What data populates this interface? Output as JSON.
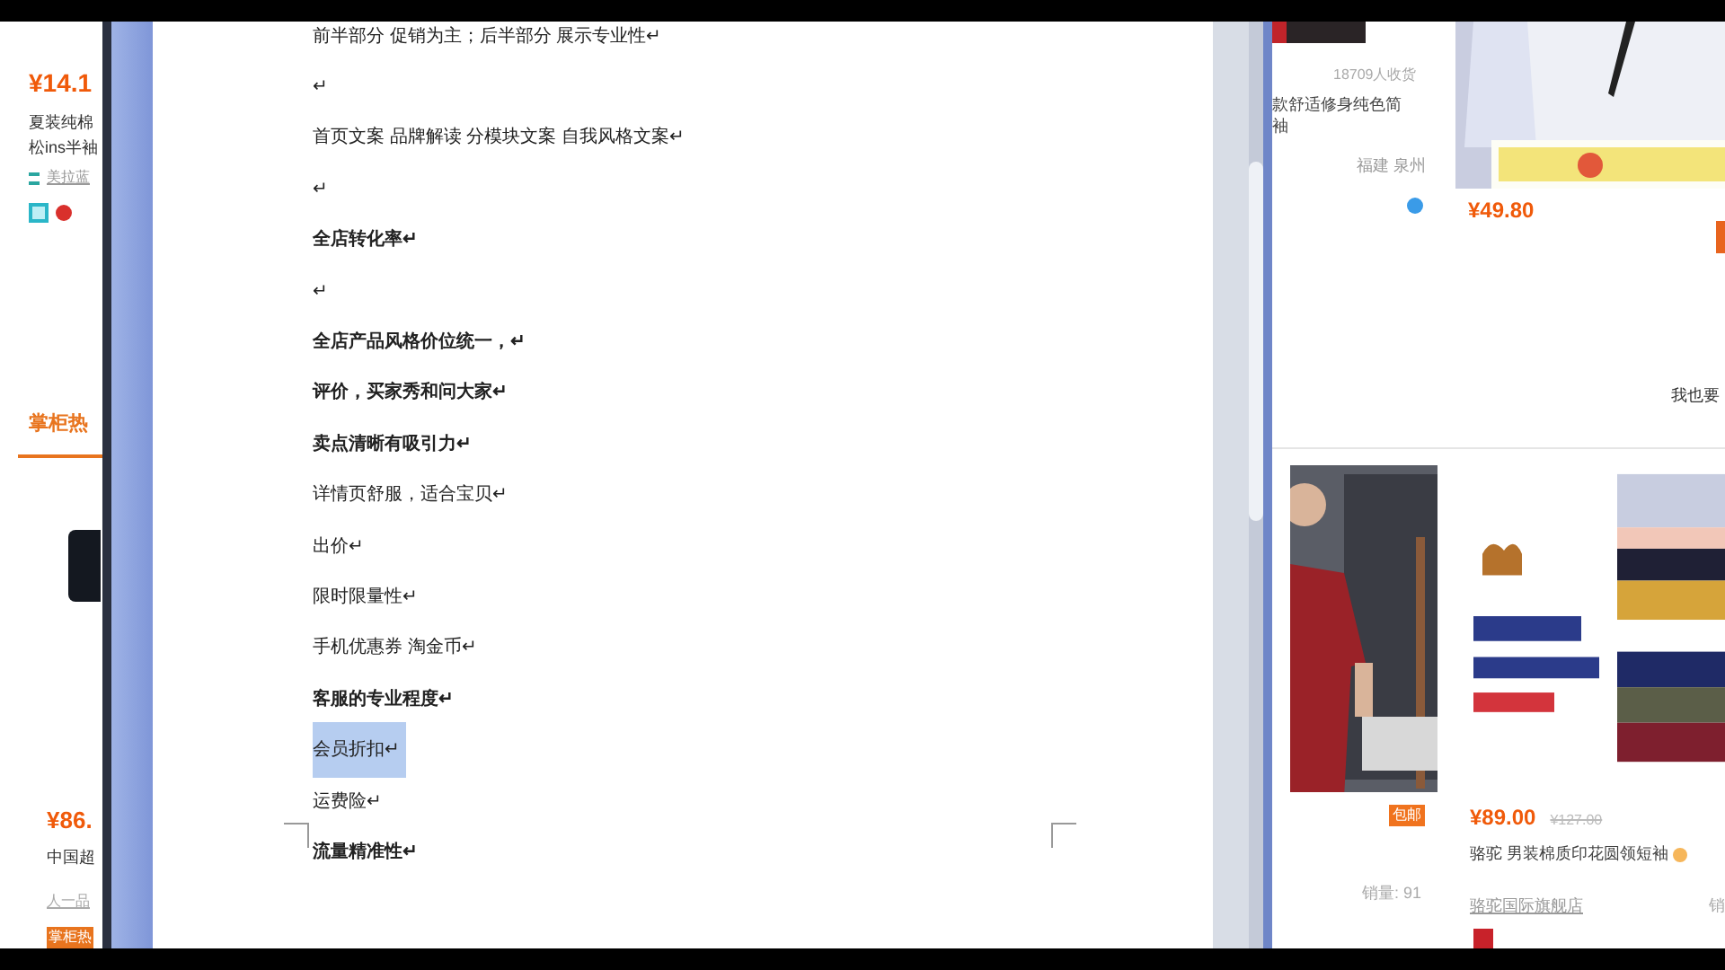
{
  "left_page": {
    "price": "¥14.1",
    "title": "夏装纯棉松ins半袖",
    "shop": "美拉蓝",
    "section_tab": "掌柜热",
    "price_2": "¥86.",
    "title_2": "中国超",
    "shop_2": "人一品",
    "badge": "掌柜热"
  },
  "document": {
    "paragraphs": [
      {
        "text": "前半部分 促销为主；后半部分 展示专业性↵",
        "bold": false,
        "selected": false
      },
      {
        "text": "↵",
        "bold": false,
        "selected": false
      },
      {
        "text": "首页文案  品牌解读  分模块文案 自我风格文案↵",
        "bold": false,
        "selected": false
      },
      {
        "text": "↵",
        "bold": false,
        "selected": false
      },
      {
        "text": "全店转化率↵",
        "bold": true,
        "selected": false
      },
      {
        "text": "↵",
        "bold": false,
        "selected": false
      },
      {
        "text": "全店产品风格价位统一，↵",
        "bold": true,
        "selected": false
      },
      {
        "text": "评价，买家秀和问大家↵",
        "bold": true,
        "selected": false
      },
      {
        "text": "卖点清晰有吸引力↵",
        "bold": true,
        "selected": false
      },
      {
        "text": "详情页舒服，适合宝贝↵",
        "bold": false,
        "selected": false
      },
      {
        "text": "出价↵",
        "bold": false,
        "selected": false
      },
      {
        "text": "限时限量性↵",
        "bold": false,
        "selected": false
      },
      {
        "text": "手机优惠券 淘金币↵",
        "bold": false,
        "selected": false
      },
      {
        "text": "客服的专业程度↵",
        "bold": true,
        "selected": false
      },
      {
        "text": "会员折扣↵",
        "bold": false,
        "selected": true
      },
      {
        "text": "运费险↵",
        "bold": false,
        "selected": false
      },
      {
        "text": "流量精准性↵",
        "bold": true,
        "selected": false
      }
    ]
  },
  "right_page": {
    "buyers": "18709人收货",
    "title": "款舒适修身纯色简袖",
    "location": "福建 泉州",
    "price": "¥49.80",
    "also_buy": "我也要",
    "free_shipping": "包邮",
    "price_2": "¥89.00",
    "old_price": "¥127.00",
    "title_2": "骆驼 男装棉质印花圆领短袖",
    "sales": "销量: 91",
    "shop_2": "骆驼国际旗舰店",
    "sales_2": "销"
  }
}
